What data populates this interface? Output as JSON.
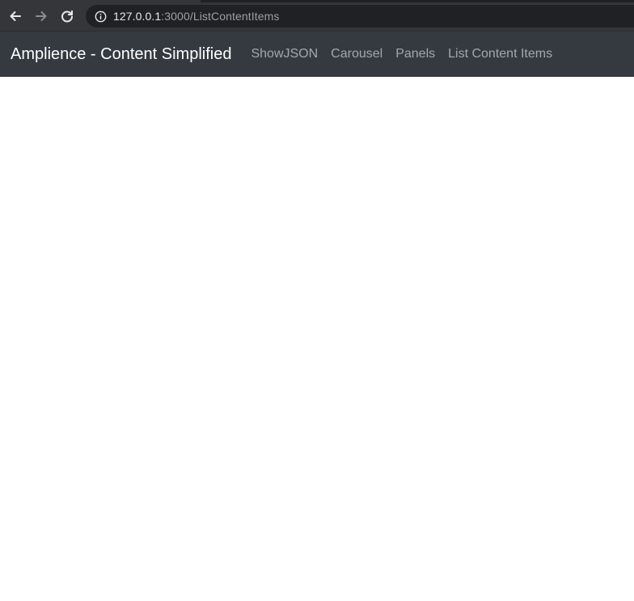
{
  "browser": {
    "icons": {
      "back": "arrow-left-icon",
      "forward": "arrow-right-icon",
      "reload": "reload-icon",
      "info": "info-icon"
    },
    "url": {
      "host": "127.0.0.1",
      "rest": ":3000/ListContentItems"
    }
  },
  "navbar": {
    "brand": "Amplience - Content Simplified",
    "links": [
      "ShowJSON",
      "Carousel",
      "Panels",
      "List Content Items"
    ]
  },
  "colors": {
    "navbar_bg": "#343a40",
    "browser_bar_bg": "#35363a",
    "omnibox_bg": "#202124"
  }
}
